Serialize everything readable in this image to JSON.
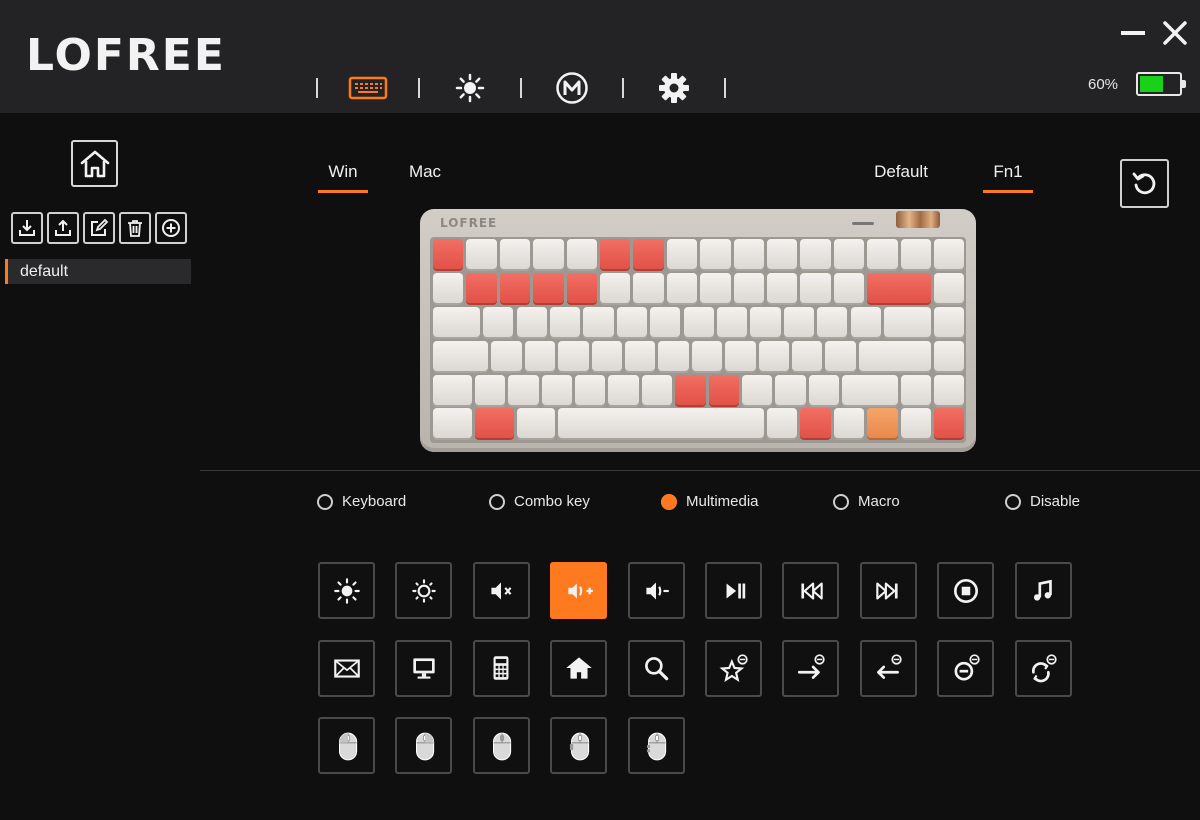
{
  "app": {
    "brand": "LOFREE"
  },
  "topnav": {
    "items": [
      {
        "name": "keyboard",
        "icon": "keyboard-icon",
        "active": true
      },
      {
        "name": "lighting",
        "icon": "brightness-icon",
        "active": false
      },
      {
        "name": "macro",
        "icon": "macro-m-icon",
        "active": false
      },
      {
        "name": "settings",
        "icon": "gear-icon",
        "active": false
      }
    ]
  },
  "battery": {
    "percent_label": "60%",
    "level": 0.6,
    "color": "#19d119"
  },
  "sidebar": {
    "tools": [
      "import-icon",
      "export-icon",
      "edit-icon",
      "delete-icon",
      "add-icon"
    ],
    "profiles": [
      {
        "label": "default",
        "active": true
      }
    ]
  },
  "os_tabs": [
    {
      "label": "Win",
      "active": true
    },
    {
      "label": "Mac",
      "active": false
    }
  ],
  "layer_tabs": [
    {
      "label": "Default",
      "active": false
    },
    {
      "label": "Fn1",
      "active": true
    }
  ],
  "keyboard": {
    "brand": "LOFREE",
    "highlight_color": "#ea5a4f",
    "selected_key_color": "#ef9658"
  },
  "modes": [
    {
      "label": "Keyboard",
      "selected": false
    },
    {
      "label": "Combo key",
      "selected": false
    },
    {
      "label": "Multimedia",
      "selected": true
    },
    {
      "label": "Macro",
      "selected": false
    },
    {
      "label": "Disable",
      "selected": false
    }
  ],
  "functions": [
    [
      "brightness-up-icon",
      "brightness-down-icon",
      "mute-icon",
      "volume-up-icon",
      "volume-down-icon",
      "play-pause-icon",
      "previous-track-icon",
      "next-track-icon",
      "stop-icon",
      "music-icon"
    ],
    [
      "mail-icon",
      "my-computer-icon",
      "calculator-icon",
      "home-page-icon",
      "search-icon",
      "browser-favorites-icon",
      "browser-forward-icon",
      "browser-back-icon",
      "browser-stop-icon",
      "browser-refresh-icon"
    ],
    [
      "mouse-left-click-icon",
      "mouse-right-click-icon",
      "mouse-middle-click-icon",
      "mouse-back-icon",
      "mouse-forward-icon"
    ]
  ],
  "selected_function": "volume-up-icon",
  "accent_color": "#ff7a1f"
}
